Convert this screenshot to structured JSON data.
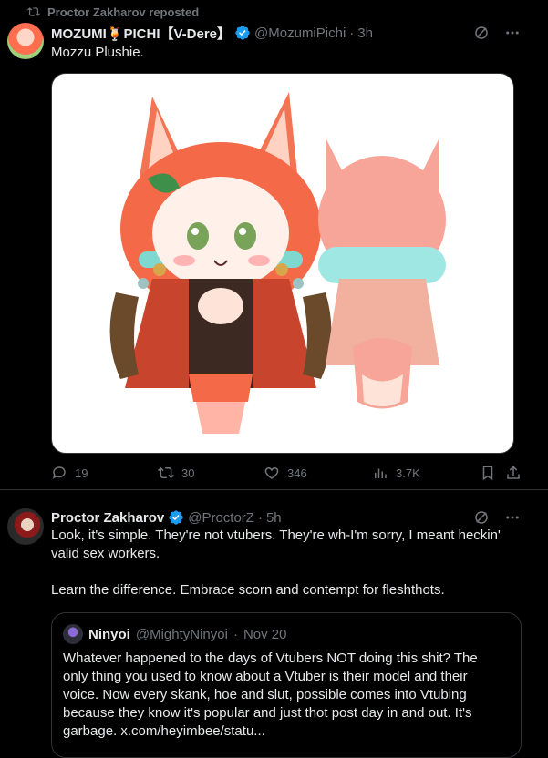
{
  "repost": {
    "label": "Proctor Zakharov reposted"
  },
  "post1": {
    "name": "MOZUMI🍹PICHI【V-Dere】",
    "handle": "@MozumiPichi",
    "dot": "·",
    "time": "3h",
    "text": "Mozzu Plushie.",
    "stats": {
      "replies": "19",
      "reposts": "30",
      "likes": "346",
      "views": "3.7K"
    }
  },
  "post2": {
    "name": "Proctor Zakharov",
    "handle": "@ProctorZ",
    "dot": "·",
    "time": "5h",
    "text_line1": "Look, it's simple. They're not vtubers. They're wh-I'm sorry, I meant heckin'",
    "text_line2": "valid sex workers.",
    "text_line3": "Learn the difference. Embrace scorn and contempt for fleshthots.",
    "quote": {
      "name": "Ninyoi",
      "handle": "@MightyNinyoi",
      "dot": "·",
      "time": "Nov 20",
      "line1": "Whatever happened to the days of Vtubers NOT doing this shit? The",
      "line2": "only thing you used to know about a Vtuber is their model and their",
      "line3": "voice. Now every skank, hoe and slut, possible comes into Vtubing",
      "line4": "because they know it's popular and just thot post day in and out. It's",
      "line5": "garbage. x.com/heyimbee/statu..."
    }
  },
  "colors": {
    "background": "#000000",
    "text": "#e7e9ea",
    "muted": "#71767b",
    "verified": "#1d9bf0",
    "border": "#2f3336"
  }
}
